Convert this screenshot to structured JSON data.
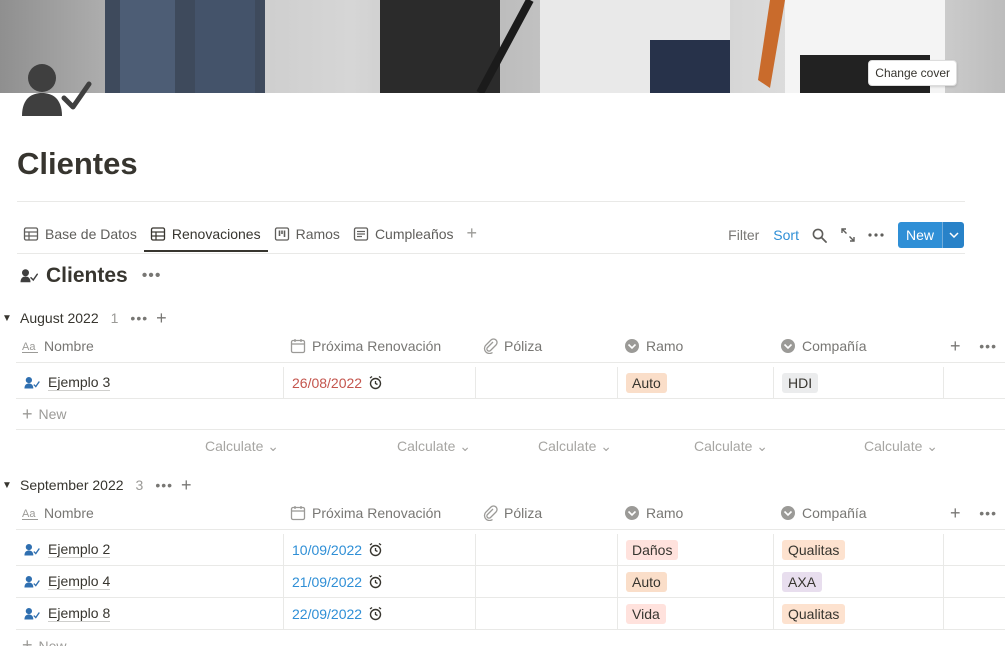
{
  "cover": {
    "change_cover_label": "Change cover"
  },
  "page": {
    "title": "Clientes"
  },
  "tabs": [
    {
      "label": "Base de Datos",
      "icon": "table-icon"
    },
    {
      "label": "Renovaciones",
      "icon": "table-icon",
      "active": true
    },
    {
      "label": "Ramos",
      "icon": "board-icon"
    },
    {
      "label": "Cumpleaños",
      "icon": "list-icon"
    }
  ],
  "toolbar": {
    "filter": "Filter",
    "sort": "Sort",
    "new": "New"
  },
  "database": {
    "title": "Clientes"
  },
  "columns": [
    "Nombre",
    "Próxima Renovación",
    "Póliza",
    "Ramo",
    "Compañía"
  ],
  "groups": [
    {
      "name": "August 2022",
      "count": "1",
      "rows": [
        {
          "name": "Ejemplo 3",
          "date": "26/08/2022",
          "ramo": "Auto",
          "compania": "HDI"
        }
      ],
      "new_label": "New",
      "calculate": [
        "Calculate",
        "Calculate",
        "Calculate",
        "Calculate",
        "Calculate"
      ]
    },
    {
      "name": "September 2022",
      "count": "3",
      "rows": [
        {
          "name": "Ejemplo 2",
          "date": "10/09/2022",
          "ramo": "Daños",
          "compania": "Qualitas"
        },
        {
          "name": "Ejemplo 4",
          "date": "21/09/2022",
          "ramo": "Auto",
          "compania": "AXA"
        },
        {
          "name": "Ejemplo 8",
          "date": "22/09/2022",
          "ramo": "Vida",
          "compania": "Qualitas"
        }
      ],
      "new_label": "New"
    }
  ],
  "colors": {
    "accent": "#2f8fd6",
    "date_overdue": "#c4554d",
    "tag_orange": "#fadec9",
    "tag_gray": "#ebeced",
    "tag_brown": "#fde2cf",
    "tag_red": "#ffe2dd",
    "tag_purple": "#e8deee"
  }
}
